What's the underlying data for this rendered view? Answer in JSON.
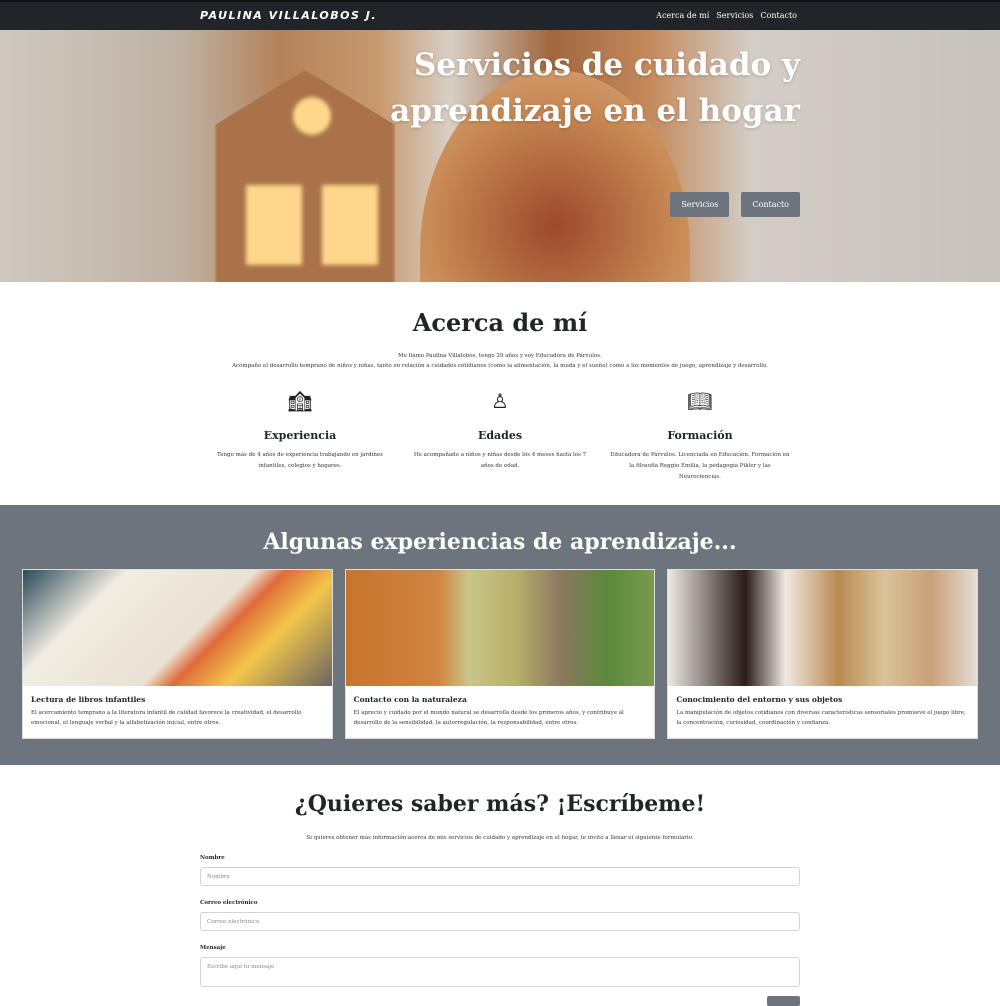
{
  "nav": {
    "brand": "PAULINA VILLALOBOS J.",
    "links": [
      "Acerca de mí",
      "Servicios",
      "Contacto"
    ]
  },
  "hero": {
    "title": "Servicios de cuidado y aprendizaje en el hogar",
    "buttons": [
      "Servicios",
      "Contacto"
    ]
  },
  "about": {
    "title": "Acerca de mí",
    "intro1": "Me llamo Paulina Villalobos, tengo 29 años y soy Educadora de Párvulos.",
    "intro2": "Acompaño el desarrollo temprano de niños y niñas, tanto en relación a cuidados cotidianos (como la alimentación, la muda y el sueño) como a los momentos de juego, aprendizaje y desarrollo.",
    "features": [
      {
        "icon": "school-icon",
        "title": "Experiencia",
        "text": "Tengo más de 4 años de experiencia trabajando en jardines infantiles, colegios y hogares."
      },
      {
        "icon": "baby-icon",
        "title": "Edades",
        "text": "He acompañado a niños y niñas desde los 4 meses hasta los 7 años de edad."
      },
      {
        "icon": "book-icon",
        "title": "Formación",
        "text": "Educadora de Párvulos. Licenciada en Educación. Formación en la filosofía Reggio Emilia, la pedagogía Pikler y las Neurociencias."
      }
    ]
  },
  "experiences": {
    "title": "Algunas experiencias de aprendizaje...",
    "cards": [
      {
        "title": "Lectura de libros infantiles",
        "text": "El acercamiento temprano a la literatura infantil de calidad favorece la creatividad, el desarrollo emocional, el lenguaje verbal y la alfabetización inicial, entre otros."
      },
      {
        "title": "Contacto con la naturaleza",
        "text": "El aprecio y cuidado por el mundo natural se desarrolla desde los primeros años, y contribuye al desarrollo de la sensibilidad, la autorregulación, la responsabilidad, entre otros."
      },
      {
        "title": "Conocimiento del entorno y sus objetos",
        "text": "La manipulación de objetos cotidianos con diversas características sensoriales promueve el juego libre, la concentración, curiosidad, coordinación y confianza."
      }
    ]
  },
  "contact": {
    "title": "¿Quieres saber más? ¡Escríbeme!",
    "intro": "Si quieres obtener más información acerca de mis servicios de cuidado y aprendizaje en el hogar, te invito a llenar el siguiente formulario.",
    "name_label": "Nombre",
    "name_placeholder": "Nombre",
    "email_label": "Correo electrónico",
    "email_placeholder": "Correo electrónico",
    "message_label": "Mensaje",
    "message_placeholder": "Escribe aquí tu mensaje"
  }
}
